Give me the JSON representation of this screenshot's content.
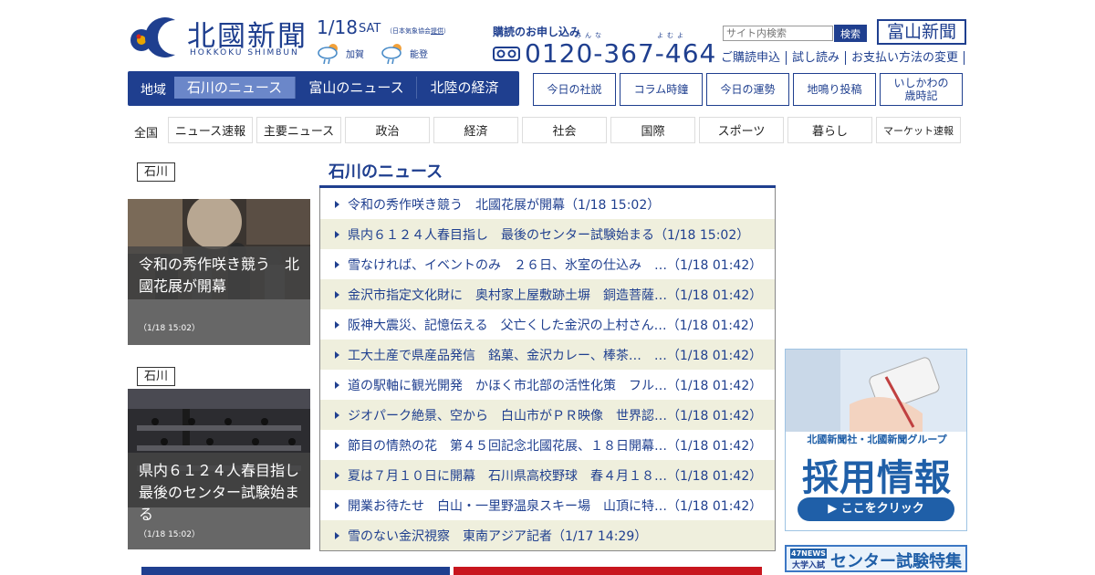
{
  "header": {
    "logo_text": "北國新聞",
    "logo_sub": "HOKKOKU SHIMBUN",
    "date": "1/18",
    "day_of_week": "SAT",
    "jma_prefix": "（日本気象協会",
    "jma_link": "提供",
    "jma_suffix": "）",
    "weather": [
      {
        "region": "加賀",
        "icon": "rain-sun-icon"
      },
      {
        "region": "能登",
        "icon": "rain-sun-icon"
      }
    ],
    "subscribe_label": "購読のお申し込み",
    "phone_ruby": [
      "みんな",
      "よむよ"
    ],
    "phone": "0120-367-464",
    "search_placeholder": "サイト内検索",
    "search_button": "検索",
    "toyama_button": "富山新聞",
    "links": [
      "ご購読申込",
      "試し読み",
      "お支払い方法の変更"
    ]
  },
  "region_nav": {
    "label": "地域",
    "items": [
      "石川のニュース",
      "富山のニュース",
      "北陸の経済"
    ],
    "active": "石川のニュース"
  },
  "topic_buttons": [
    "今日の社説",
    "コラム時鐘",
    "今日の運勢",
    "地鳴り投稿",
    "いしかわの歳時記"
  ],
  "category_nav": {
    "label": "全国",
    "tabs": [
      "ニュース速報",
      "主要ニュース",
      "政治",
      "経済",
      "社会",
      "国際",
      "スポーツ",
      "暮らし",
      "マーケット速報"
    ]
  },
  "features": [
    {
      "tag": "石川",
      "title": "令和の秀作咲き競う　北國花展が開幕",
      "time": "（1/18 15:02）"
    },
    {
      "tag": "石川",
      "title": "県内６１２４人春目指し　最後のセンター試験始まる",
      "time": "（1/18 15:02）"
    }
  ],
  "news_list": {
    "title": "石川のニュース",
    "items": [
      "令和の秀作咲き競う　北國花展が開幕（1/18 15:02）",
      "県内６１２４人春目指し　最後のセンター試験始まる（1/18 15:02）",
      "雪なければ、イベントのみ　２６日、氷室の仕込み　…（1/18 01:42）",
      "金沢市指定文化財に　奥村家上屋敷跡土塀　銅造菩薩…（1/18 01:42）",
      "阪神大震災、記憶伝える　父亡くした金沢の上村さん…（1/18 01:42）",
      "工大土産で県産品発信　銘菓、金沢カレー、棒茶…　…（1/18 01:42）",
      "道の駅軸に観光開発　かほく市北部の活性化策　フル…（1/18 01:42）",
      "ジオパーク絶景、空から　白山市がＰＲ映像　世界認…（1/18 01:42）",
      "節目の情熱の花　第４５回記念北國花展、１８日開幕…（1/18 01:42）",
      "夏は７月１０日に開幕　石川県高校野球　春４月１８…（1/18 01:42）",
      "開業お待たせ　白山・一里野温泉スキー場　山頂に特…（1/18 01:42）",
      "雪のない金沢視察　東南アジア記者（1/17 14:29）"
    ]
  },
  "ads": {
    "recruit_top": "北國新聞社・北國新聞グループ",
    "recruit_main": "採用情報",
    "recruit_button": "▶ ここをクリック",
    "center_badge_top": "47NEWS",
    "center_badge_bottom": "大学入試",
    "center_text": "センター試験特集"
  },
  "colors": {
    "brand": "#1f3f8f",
    "active_tab": "#6b87c9",
    "row_alt": "#efefdd"
  }
}
